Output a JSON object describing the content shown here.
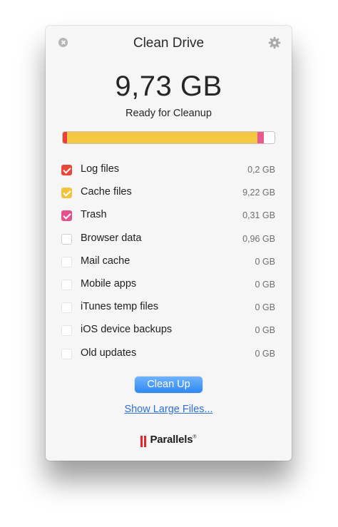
{
  "window": {
    "title": "Clean Drive",
    "total_size": "9,73 GB",
    "status": "Ready for Cleanup"
  },
  "usage_bar": {
    "segments": [
      {
        "name": "Log files",
        "fraction": 0.021,
        "color": "#e8403a"
      },
      {
        "name": "Cache files",
        "fraction": 0.898,
        "color": "#f5c842"
      },
      {
        "name": "Trash",
        "fraction": 0.03,
        "color": "#e85a8e"
      }
    ]
  },
  "items": [
    {
      "label": "Log files",
      "size": "0,2 GB",
      "checked": true,
      "color": "#e8453c",
      "enabled": true
    },
    {
      "label": "Cache files",
      "size": "9,22 GB",
      "checked": true,
      "color": "#f2c43d",
      "enabled": true
    },
    {
      "label": "Trash",
      "size": "0,31 GB",
      "checked": true,
      "color": "#e4508b",
      "enabled": true
    },
    {
      "label": "Browser data",
      "size": "0,96 GB",
      "checked": false,
      "color": "",
      "enabled": true
    },
    {
      "label": "Mail cache",
      "size": "0 GB",
      "checked": false,
      "color": "",
      "enabled": false
    },
    {
      "label": "Mobile apps",
      "size": "0 GB",
      "checked": false,
      "color": "",
      "enabled": false
    },
    {
      "label": "iTunes temp files",
      "size": "0 GB",
      "checked": false,
      "color": "",
      "enabled": false
    },
    {
      "label": "iOS device backups",
      "size": "0 GB",
      "checked": false,
      "color": "",
      "enabled": false
    },
    {
      "label": "Old updates",
      "size": "0 GB",
      "checked": false,
      "color": "",
      "enabled": false
    }
  ],
  "actions": {
    "clean_up_label": "Clean Up",
    "large_files_link": "Show Large Files..."
  },
  "brand": {
    "name": "Parallels",
    "mark": "®",
    "color": "#e8232a"
  },
  "icons": {
    "close": "close-icon",
    "settings": "gear-icon",
    "logo": "parallels-bars-icon"
  }
}
